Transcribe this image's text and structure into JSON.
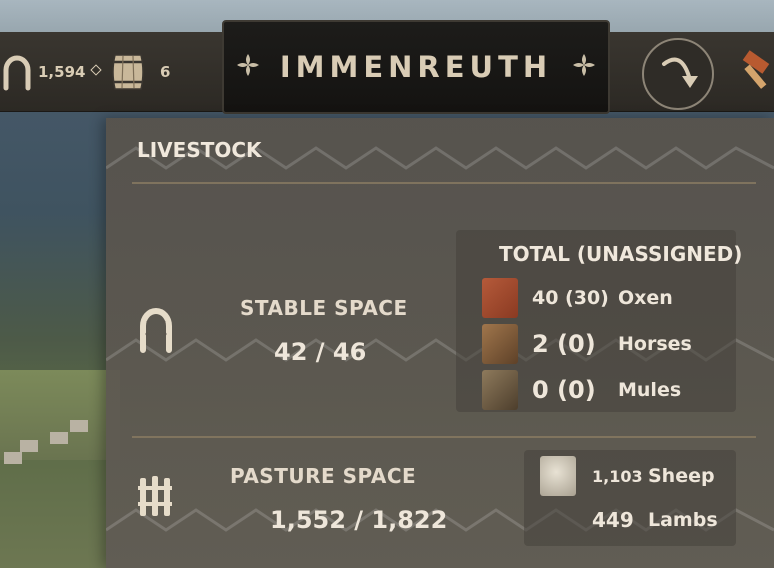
{
  "topbar": {
    "horseshoe_value": "1,594",
    "barrel_value": "6",
    "settlement_name": "IMMENREUTH"
  },
  "panel": {
    "title": "LIVESTOCK",
    "stable": {
      "label": "STABLE SPACE",
      "value": "42 / 46"
    },
    "total_header": "TOTAL (UNASSIGNED)",
    "animals": [
      {
        "count": "40 (30)",
        "name": "Oxen",
        "icon": "ox-portrait-icon"
      },
      {
        "count": "2 (0)",
        "name": "Horses",
        "icon": "horse-portrait-icon"
      },
      {
        "count": "0 (0)",
        "name": "Mules",
        "icon": "mule-portrait-icon"
      }
    ],
    "pasture": {
      "label": "PASTURE SPACE",
      "value": "1,552 / 1,822"
    },
    "pasture_animals": [
      {
        "count": "1,103",
        "name": "Sheep",
        "icon": "sheep-portrait-icon"
      },
      {
        "count": "449",
        "name": "Lambs"
      }
    ]
  },
  "colors": {
    "text": "#eee6da",
    "accent_gold": "#d9ccb5",
    "panel_bg": "#5a554e",
    "topbar_bg": "#2c2924"
  }
}
